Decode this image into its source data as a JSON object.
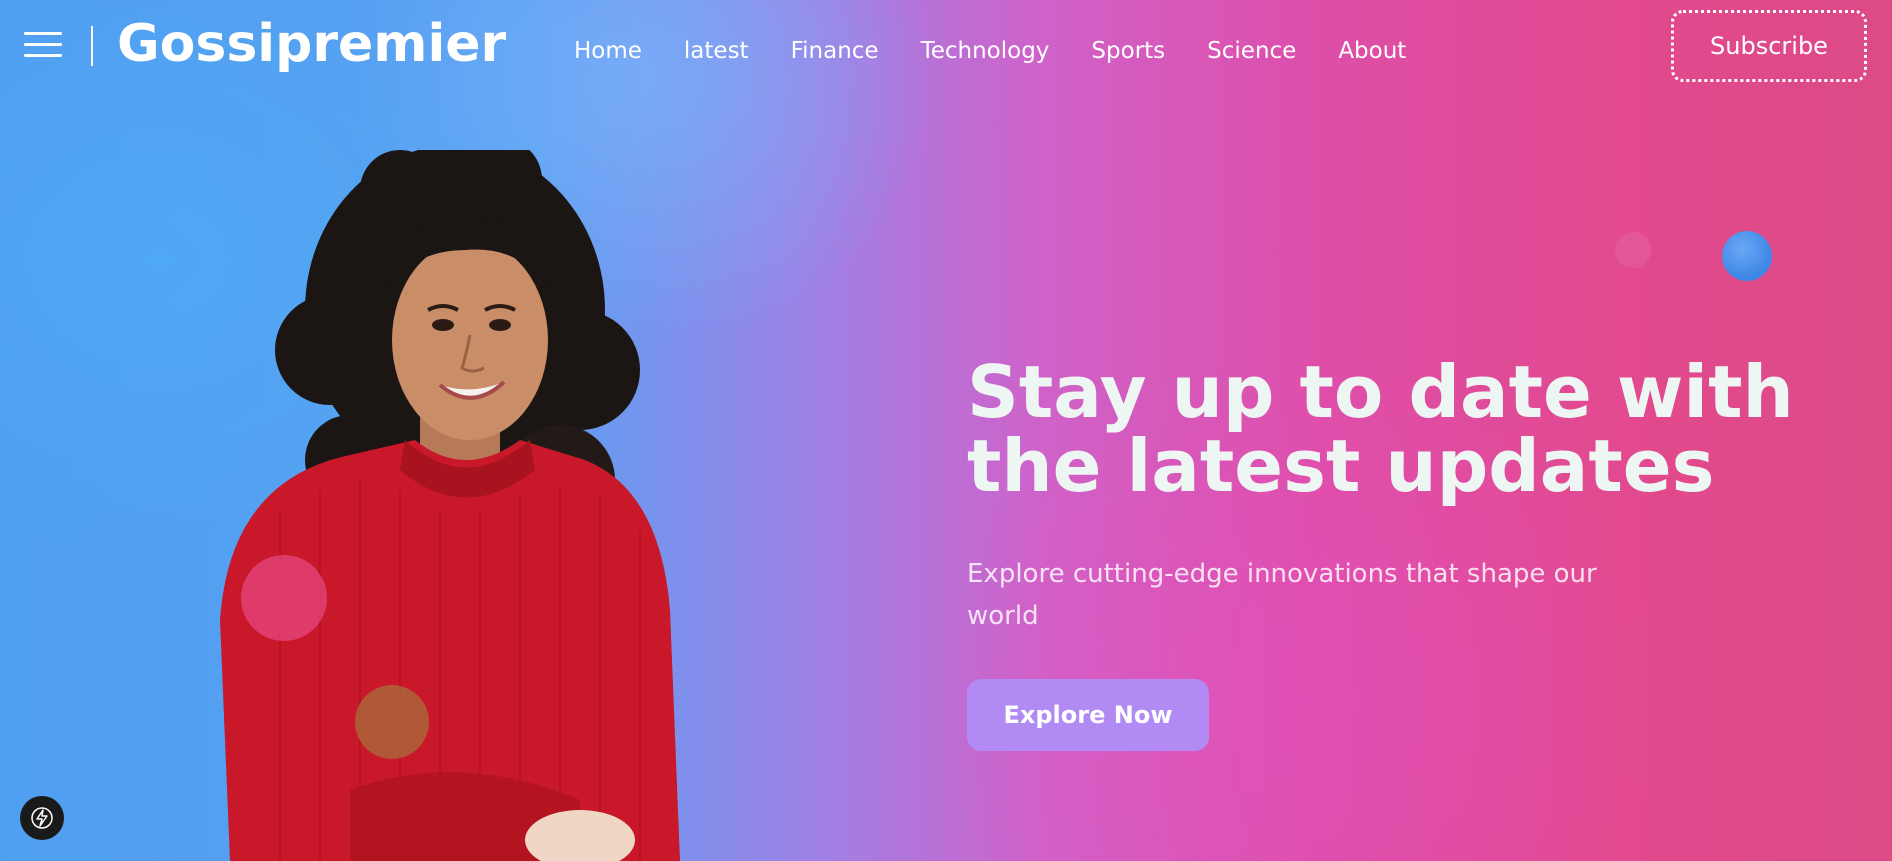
{
  "header": {
    "brand": "Gossipremier",
    "nav": [
      "Home",
      "latest",
      "Finance",
      "Technology",
      "Sports",
      "Science",
      "About"
    ],
    "subscribe_label": "Subscribe"
  },
  "hero": {
    "title_line1": "Stay up to date with",
    "title_line2": "the latest updates",
    "subtitle": "Explore cutting-edge innovations that shape our world",
    "cta_label": "Explore Now"
  },
  "icons": {
    "menu": "hamburger-menu-icon",
    "corner_badge": "lightning-bolt-icon"
  },
  "colors": {
    "gradient_left": "#4f9ff0",
    "gradient_mid": "#cf62c9",
    "gradient_right": "#dc4b86",
    "cta_bg": "#b28af3",
    "title": "#eef6f4",
    "sweater": "#c8182a"
  }
}
